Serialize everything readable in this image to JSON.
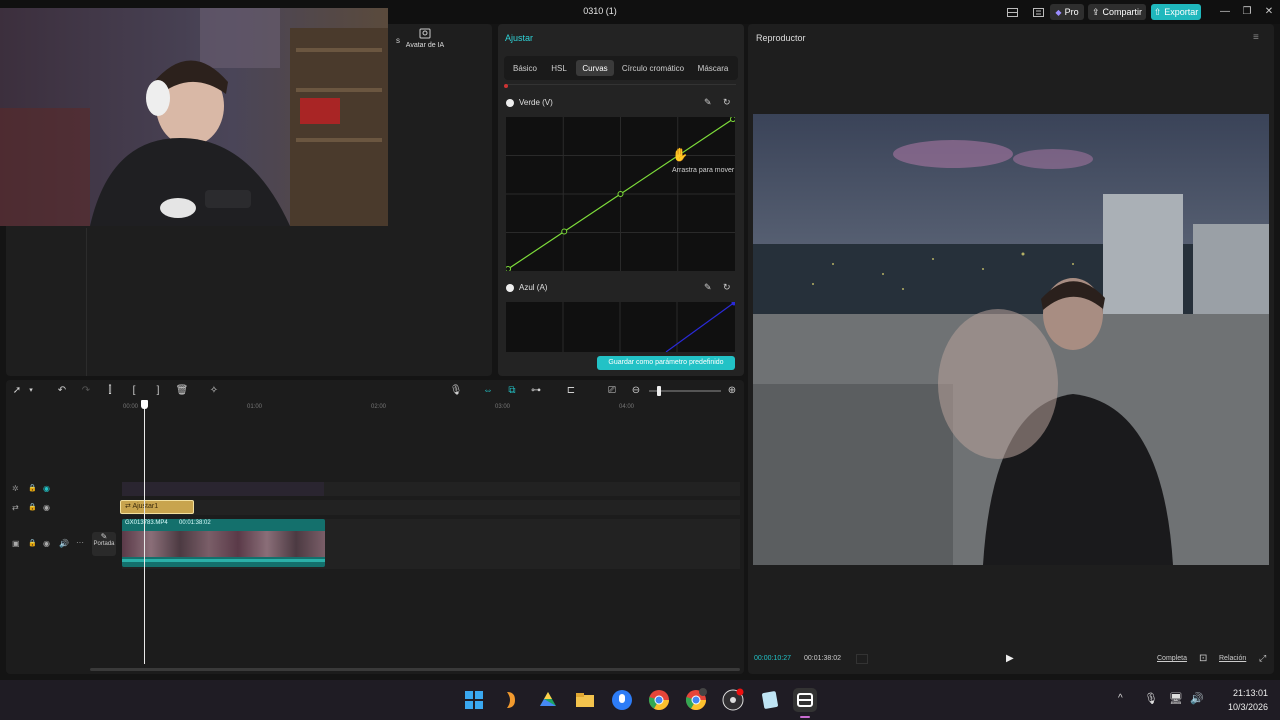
{
  "titlebar": {
    "title": "0310 (1)",
    "pro_label": "Pro",
    "share_label": "Compartir",
    "export_label": "Exportar"
  },
  "media": {
    "ai_avatar_label": "Avatar de IA",
    "cut_letter": "s"
  },
  "adjust": {
    "title": "Ajustar",
    "tabs": [
      "Básico",
      "HSL",
      "Curvas",
      "Círculo cromático",
      "Máscara"
    ],
    "active_tab": "Curvas",
    "green_label": "Verde (V)",
    "blue_label": "Azul (A)",
    "tooltip": "Arrastra para mover",
    "save_preset_label": "Guardar como parámetro predefinido",
    "green_curve_points": [
      [
        0,
        0
      ],
      [
        0.25,
        0.25
      ],
      [
        0.5,
        0.5
      ],
      [
        1,
        1
      ]
    ],
    "colors": {
      "accent": "#22c2c6",
      "green": "#7ddc3a",
      "blue": "#2a2ad8"
    }
  },
  "timeline": {
    "ruler": [
      "00:00",
      "01:00",
      "02:00",
      "03:00",
      "04:00"
    ],
    "adjust_clip_label": "Ajustar1",
    "video_clip_name": "GX013783.MP4",
    "video_clip_duration": "00:01:38:02",
    "cover_label": "Portada",
    "playhead_time": "00:00"
  },
  "player": {
    "title": "Reproductor",
    "current_time": "00:00:10:27",
    "total_time": "00:01:38:02",
    "full_label": "Completa",
    "ratio_label": "Relación"
  },
  "taskbar": {
    "time": "21:13:01",
    "date": "10/3/2026"
  }
}
